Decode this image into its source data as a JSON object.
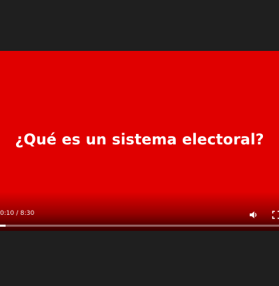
{
  "video": {
    "title_overlay": "¿Qué es un sistema electoral?",
    "background_color": "#e00000"
  },
  "controls": {
    "time_display": "0:10 / 8:30",
    "progress_fraction": 0.0196,
    "volume_icon": "volume-icon",
    "fullscreen_icon": "fullscreen-icon"
  }
}
